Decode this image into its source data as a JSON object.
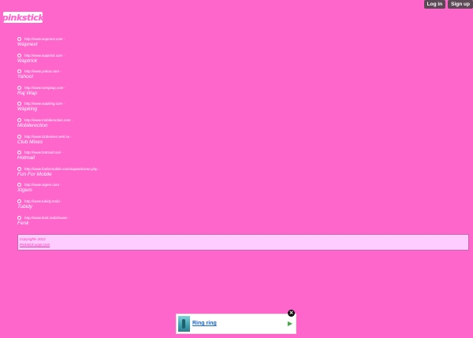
{
  "topbar": {
    "login_label": "Log in",
    "signup_label": "Sign up"
  },
  "logo": {
    "text": "pinkstick"
  },
  "links": [
    {
      "url": "http://www.wapnext.com -",
      "name": "Wapnext"
    },
    {
      "url": "http://www.waptrick.com -",
      "name": "Waptrick"
    },
    {
      "url": "http://www.yahoo.com -",
      "name": "Yahoo!"
    },
    {
      "url": "http://www.rwrsjwap.com -",
      "name": "Raj Wap"
    },
    {
      "url": "http://www.wapking.com -",
      "name": "Wapking"
    },
    {
      "url": "http://www.mobilerection.com -",
      "name": "Mobilerection"
    },
    {
      "url": "http://www.clubmixes.wml.su -",
      "name": "Club Mixes"
    },
    {
      "url": "http://www.hotmail.com -",
      "name": "Hotmail"
    },
    {
      "url": "http://www.funformobile.com/wapwelcome.php -",
      "name": "Fun For Mobile"
    },
    {
      "url": "http://www.xtgem.com -",
      "name": "Xtgem"
    },
    {
      "url": "http://www.tubidy.mobi -",
      "name": "Tubidy"
    },
    {
      "url": "http://www.fenk.mobi/music -",
      "name": "Fenk"
    }
  ],
  "footer": {
    "copyright": "Copyrights 2012",
    "site_link": "Pinkstick.wapt.com"
  },
  "ad": {
    "title": "Ring ring",
    "play_icon": "play-arrow-icon",
    "close_icon": "close-icon"
  },
  "colors": {
    "background": "#ff66cc",
    "footer_bg": "#ffccff",
    "button_bg": "#5b4a55"
  }
}
